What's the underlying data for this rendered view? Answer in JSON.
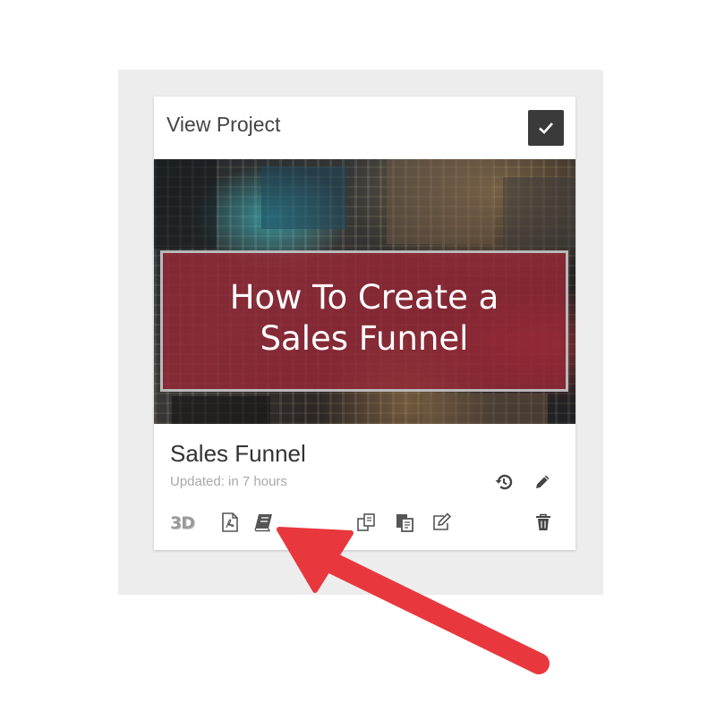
{
  "card": {
    "header_title": "View Project",
    "thumbnail": {
      "line1": "How To Create a",
      "line2": "Sales Funnel"
    },
    "project_name": "Sales Funnel",
    "updated_text": "Updated: in 7 hours",
    "badge_3d": "3D",
    "icons": {
      "check": "check-icon",
      "history": "history-icon",
      "edit": "pencil-icon",
      "pdf": "pdf-icon",
      "ebook": "book-icon",
      "clone": "clone-icon",
      "copy": "copy-icon",
      "edit_doc": "edit-doc-icon",
      "delete": "trash-icon"
    }
  },
  "colors": {
    "panel_bg": "#ededed",
    "banner": "#962837",
    "arrow": "#e8383d",
    "icon": "#555555"
  }
}
